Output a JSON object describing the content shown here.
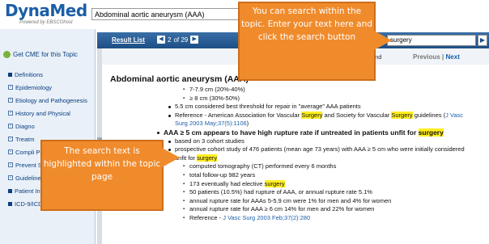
{
  "header": {
    "logo": "DynaMed",
    "logo_sub": "Powered by EBSCOhost",
    "topic_value": "Abdominal aortic aneurysm (AAA)"
  },
  "sidebar": {
    "cme_label": "Get CME for this Topic",
    "items": [
      {
        "label": "Definitions",
        "kind": "square"
      },
      {
        "label": "Epidemiology",
        "kind": "expand"
      },
      {
        "label": "Etiology and Pathogenesis",
        "kind": "expand"
      },
      {
        "label": "History and Physical",
        "kind": "expand"
      },
      {
        "label": "Diagno",
        "kind": "expand"
      },
      {
        "label": "Treatm",
        "kind": "expand"
      },
      {
        "label": "Compli Progno",
        "kind": "expand"
      },
      {
        "label": "Prevent Screeni",
        "kind": "expand"
      },
      {
        "label": "Guidelines and Resources",
        "kind": "expand"
      },
      {
        "label": "Patient Information",
        "kind": "square"
      },
      {
        "label": "ICD-9/ICD-10 Codes",
        "kind": "square"
      }
    ]
  },
  "toolbar": {
    "result_list": "Result List",
    "page_current": "2",
    "page_of": "of 29",
    "search_value": "surgery",
    "found_text": "gery found",
    "prev": "Previous",
    "sep": "|",
    "next": "Next"
  },
  "topic_title": "Abdominal aortic aneurysm (AAA)",
  "content": {
    "l01": "7-7.9 cm (20%-40%)",
    "l02": "≥ 8 cm (30%-50%)",
    "l03": "5.5 cm considered best threshold for repair in \"average\" AAA patients",
    "l04a": "Reference - American Association for Vascular ",
    "l04b": "Surgery",
    "l04c": " and Society for Vascular ",
    "l04d": "Surgery",
    "l04e": " guidelines (",
    "l04f": "J Vasc",
    "l05": "Surg 2003 May;37(5):1106",
    "l05b": ")",
    "l06a": "AAA ≥ 5 cm appears to have high rupture rate if untreated in patients unfit for ",
    "l06b": "surgery",
    "l07": "based on 3 cohort studies",
    "l08": "prospective cohort study of 476 patients (mean age 73 years) with AAA ≥ 5 cm who were initially considered",
    "l09a": "unfit for ",
    "l09b": "surgery",
    "l10": "computed tomography (CT) performed every 6 months",
    "l11": "total follow-up 982 years",
    "l12a": "173 eventually had elective ",
    "l12b": "surgery",
    "l13": "50 patients (10.5%) had rupture of AAA, or annual rupture rate 5.1%",
    "l14": "annual rupture rate for AAAs 5-5.9 cm were 1% for men and 4% for women",
    "l15": "annual rupture rate for AAA ≥ 6 cm 14% for men and 22% for women",
    "l16a": "Reference - ",
    "l16b": "J Vasc Surg 2003 Feb;37(2):280"
  },
  "callouts": {
    "top": "You can search within the topic. Enter your text here and click the search button",
    "bottom": "The search text is highlighted within the topic page"
  },
  "colors": {
    "brand": "#1b5ea8",
    "toolbar": "#1d4f86",
    "highlight": "#ffef1f",
    "callout": "#f08b2c"
  }
}
